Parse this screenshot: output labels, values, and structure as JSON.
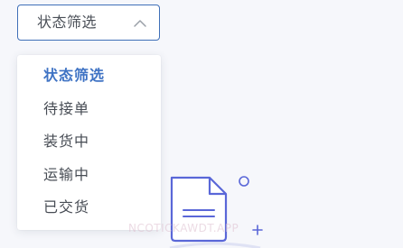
{
  "filter": {
    "selected_label": "状态筛选",
    "options": [
      {
        "label": "状态筛选",
        "active": true
      },
      {
        "label": "待接单",
        "active": false
      },
      {
        "label": "装货中",
        "active": false
      },
      {
        "label": "运输中",
        "active": false
      },
      {
        "label": "已交货",
        "active": false
      }
    ]
  },
  "empty_state": {
    "icon": "document-add-icon"
  },
  "watermark": {
    "text": "NCOTICKAWDT.APP"
  },
  "colors": {
    "accent": "#3f73c4",
    "border": "#3f6fb8",
    "text": "#474c54",
    "illustration": "#5a67d8",
    "background": "#f6f7fb"
  }
}
